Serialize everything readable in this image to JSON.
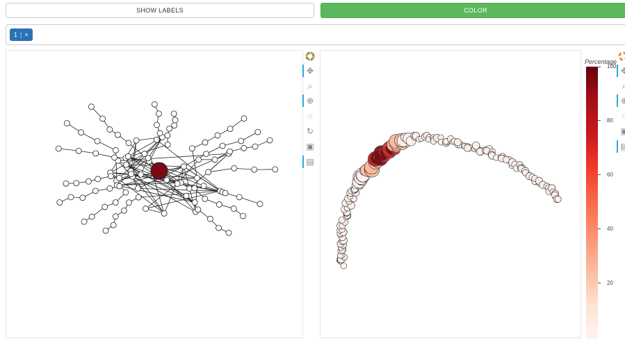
{
  "buttons": {
    "show_labels": "SHOW LABELS",
    "color": "COLOR"
  },
  "selector": {
    "chip_value": "1",
    "chip_close": "×"
  },
  "colorbar": {
    "title": "Percentage",
    "ticks": [
      "100",
      "80",
      "60",
      "40",
      "20"
    ],
    "colormap": "Reds"
  },
  "colors": {
    "accent_green": "#5cb85c",
    "chip_blue": "#2a72b5",
    "toolbar_active": "#26aae1"
  },
  "toolbar_icons": [
    "bokeh-logo-icon",
    "pan-icon",
    "box-zoom-icon",
    "wheel-zoom-icon",
    "lasso-icon",
    "reset-icon",
    "save-icon",
    "hover-icon"
  ]
}
